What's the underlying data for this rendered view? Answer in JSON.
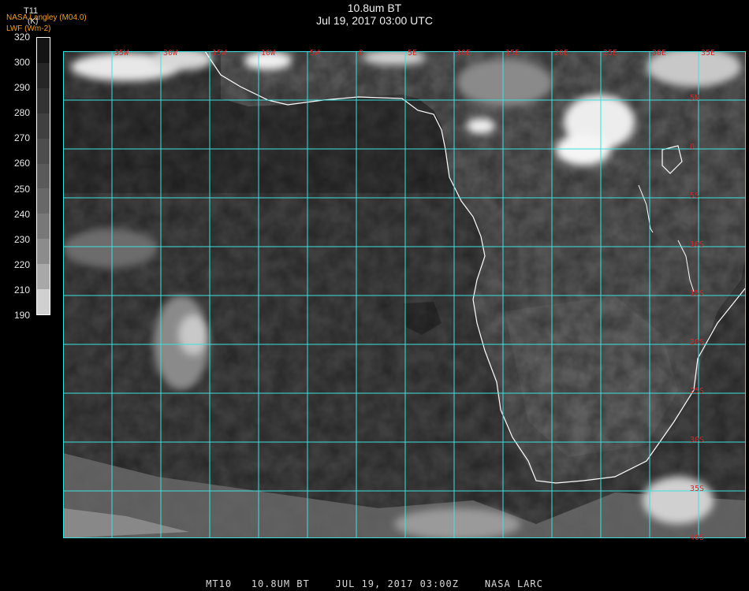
{
  "header": {
    "title": "10.8um BT",
    "datetime": "Jul 19, 2017 03:00 UTC",
    "credit_line1": "NASA Langley (M04.0)",
    "credit_line2": "LWF (Wm-2)"
  },
  "colorbar": {
    "parameter": "T11",
    "unit": "(K)",
    "tick_labels": [
      "320",
      "300",
      "290",
      "280",
      "270",
      "260",
      "250",
      "240",
      "230",
      "220",
      "210",
      "190"
    ],
    "colors": [
      "#141414",
      "#262626",
      "#333333",
      "#404040",
      "#4d4d4d",
      "#5a5a5a",
      "#686868",
      "#787878",
      "#8c8c8c",
      "#a8a8a8",
      "#d0d0d0",
      "#ffffff"
    ]
  },
  "map": {
    "grid_color": "#40e0e0",
    "label_color": "#c03030",
    "coast_color": "#ffffff",
    "lon_labels": [
      "35W",
      "30W",
      "15W",
      "10W",
      "5W",
      "0",
      "5E",
      "10E",
      "15E",
      "20E",
      "25E",
      "30E",
      "35E"
    ],
    "lat_labels": [
      "5N",
      "0",
      "5S",
      "10S",
      "15S",
      "20S",
      "25S",
      "30S",
      "35S",
      "40S"
    ]
  },
  "footer": {
    "text": "MT10   10.8UM BT    JUL 19, 2017 03:00Z    NASA LARC"
  }
}
